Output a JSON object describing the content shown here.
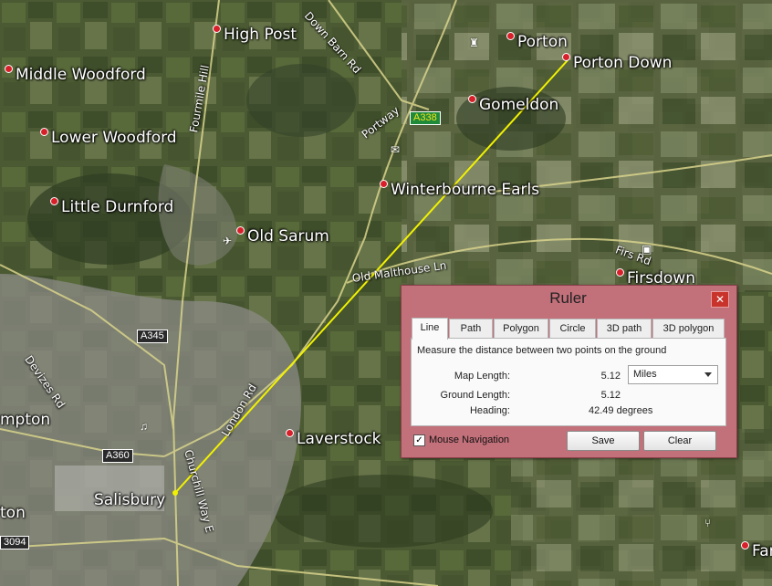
{
  "map": {
    "places": [
      "High Post",
      "Porton",
      "Porton Down",
      "Middle Woodford",
      "Gomeldon",
      "Lower Woodford",
      "Winterbourne Earls",
      "Little Durnford",
      "Old Sarum",
      "Firsdown",
      "Laverstock",
      "Salisbury",
      "mpton",
      "ton",
      "Far"
    ],
    "roads": [
      "Down Barn Rd",
      "Fourmile Hill",
      "Portway",
      "Old Malthouse Ln",
      "Firs Rd",
      "Devizes Rd",
      "London Rd",
      "Churchill Way E"
    ],
    "shields": [
      "A338",
      "A345",
      "A360",
      "3094"
    ],
    "measure_line_color": "#f2f200"
  },
  "ruler": {
    "title": "Ruler",
    "close_label": "✕",
    "tabs": [
      "Line",
      "Path",
      "Polygon",
      "Circle",
      "3D path",
      "3D polygon"
    ],
    "active_tab": "Line",
    "description": "Measure the distance between two points on the ground",
    "map_length_label": "Map Length:",
    "map_length_value": "5.12",
    "unit": "Miles",
    "ground_length_label": "Ground Length:",
    "ground_length_value": "5.12",
    "heading_label": "Heading:",
    "heading_value": "42.49 degrees",
    "mouse_navigation_label": "Mouse Navigation",
    "mouse_navigation_checked": "✓",
    "save_label": "Save",
    "clear_label": "Clear"
  }
}
